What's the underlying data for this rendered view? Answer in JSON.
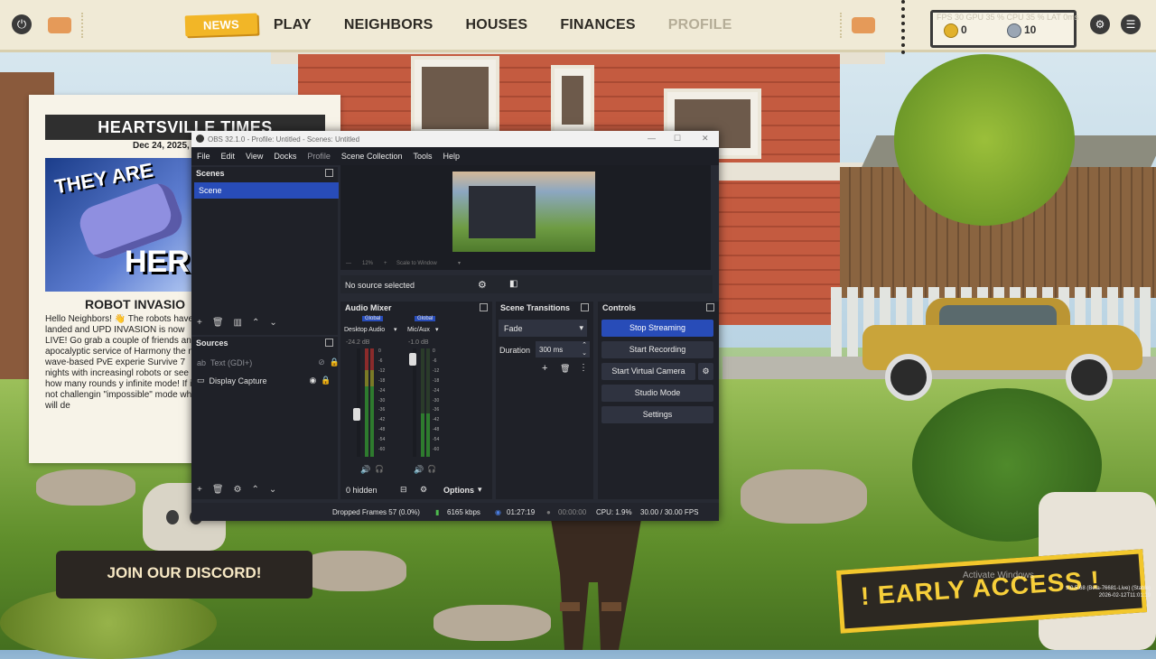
{
  "topbar": {
    "nav": [
      "NEWS",
      "PLAY",
      "NEIGHBORS",
      "HOUSES",
      "FINANCES",
      "PROFILE"
    ],
    "active_index": 0,
    "disabled_index": 5,
    "overlay_text": "FPS 30   GPU 35 %   CPU 35 %   LAT 0ms",
    "coins": "0",
    "gems": "10"
  },
  "newspaper": {
    "title": "HEARTSVILLE TIMES",
    "date": "Dec 24, 2025,",
    "image_top": "THEY ARE",
    "image_bottom": "HERE!",
    "headline": "ROBOT INVASIO",
    "body": "Hello Neighbors! 👋 The robots have landed and UPD INVASION is now LIVE! Go grab a couple of friends and apocalyptic service of Harmony the new wave-based PvE experie Survive 7 nights with increasingl robots or see how many rounds y infinite mode! If its not challengin \"impossible\" mode which will de"
  },
  "discord": {
    "label": "JOIN OUR DISCORD!"
  },
  "early_access": {
    "label": "! EARLY ACCESS !"
  },
  "watermark": {
    "activate": "Activate Windows",
    "build": "9.0.5.68 (Beta-76681-Live) (Stable)\n2026-02-12T11:01:19"
  },
  "obs": {
    "title": "OBS 32.1.0 - Profile: Untitled - Scenes: Untitled",
    "menu": [
      "File",
      "Edit",
      "View",
      "Docks",
      "Profile",
      "Scene Collection",
      "Tools",
      "Help"
    ],
    "scenes_title": "Scenes",
    "scene_selected": "Scene",
    "sources_title": "Sources",
    "sources": [
      {
        "name": "Text (GDI+)",
        "visible": false
      },
      {
        "name": "Display Capture",
        "visible": true
      }
    ],
    "preview_zoom": "12%",
    "preview_scale": "Scale to Window",
    "no_source": "No source selected",
    "audio_mixer_title": "Audio Mixer",
    "channels": [
      {
        "badge": "Global",
        "name": "Desktop Audio",
        "db": "-24.2 dB"
      },
      {
        "badge": "Global",
        "name": "Mic/Aux",
        "db": "-1.0 dB"
      }
    ],
    "meter_ticks": [
      "0",
      "-6",
      "-12",
      "-18",
      "-24",
      "-30",
      "-36",
      "-42",
      "-48",
      "-54",
      "-60"
    ],
    "hidden_label": "0 hidden",
    "options_label": "Options",
    "transitions_title": "Scene Transitions",
    "transition": "Fade",
    "duration_label": "Duration",
    "duration_value": "300 ms",
    "controls_title": "Controls",
    "controls": [
      "Stop Streaming",
      "Start Recording",
      "Start Virtual Camera",
      "Studio Mode",
      "Settings"
    ],
    "status": {
      "dropped": "Dropped Frames 57 (0.0%)",
      "bitrate": "6165 kbps",
      "stream_time": "01:27:19",
      "rec_time": "00:00:00",
      "cpu": "CPU: 1.9%",
      "fps": "30.00 / 30.00 FPS"
    }
  },
  "colors": {
    "accent": "#284cb8",
    "news": "#f2b627",
    "early": "#f2c72c"
  }
}
